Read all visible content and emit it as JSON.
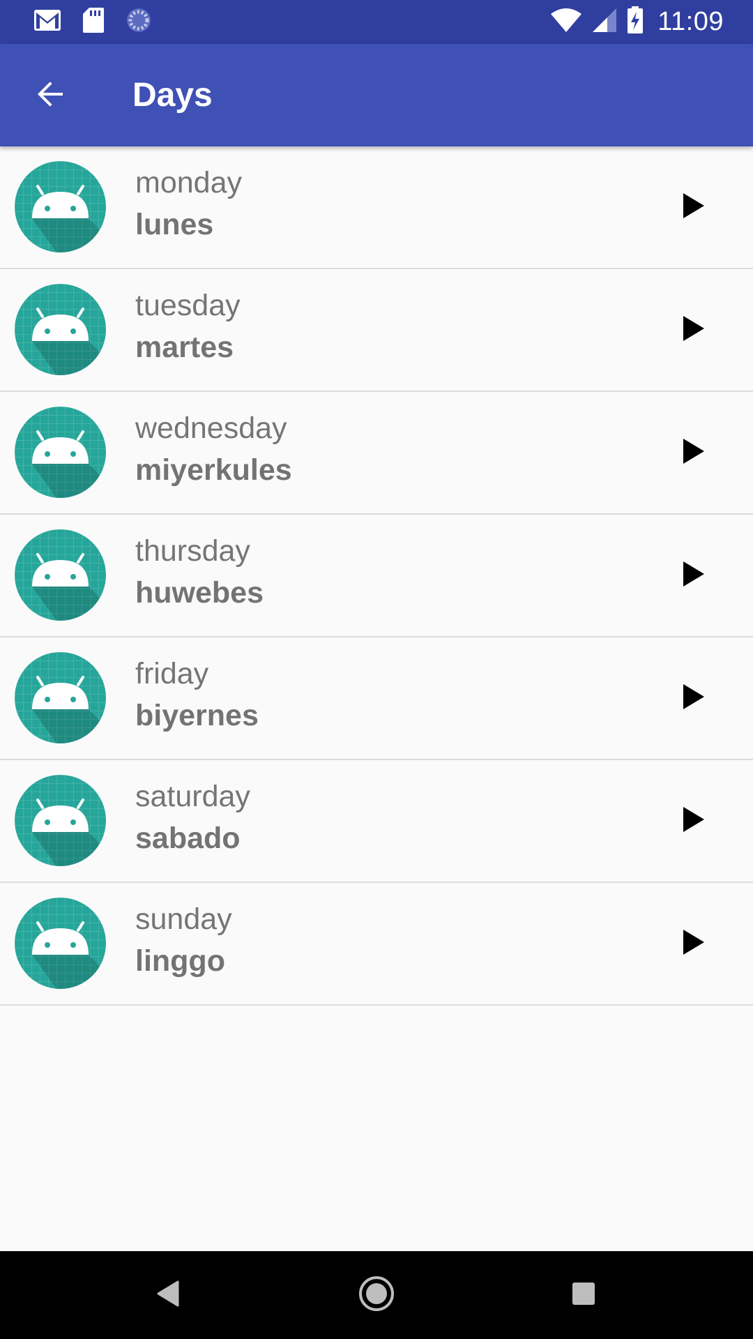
{
  "status_bar": {
    "time": "11:09",
    "left_icons": [
      "gmail-icon",
      "sd-card-icon",
      "sync-icon"
    ],
    "right_icons": [
      "wifi-icon",
      "cell-signal-icon",
      "battery-charging-icon"
    ]
  },
  "app_bar": {
    "title": "Days",
    "back_icon": "arrow-back-icon"
  },
  "days": [
    {
      "english": "monday",
      "translation": "lunes"
    },
    {
      "english": "tuesday",
      "translation": "martes"
    },
    {
      "english": "wednesday",
      "translation": "miyerkules"
    },
    {
      "english": "thursday",
      "translation": "huwebes"
    },
    {
      "english": "friday",
      "translation": "biyernes"
    },
    {
      "english": "saturday",
      "translation": "sabado"
    },
    {
      "english": "sunday",
      "translation": "linggo"
    }
  ],
  "row_icons": {
    "avatar": "android-icon",
    "action": "play-icon"
  },
  "nav_bar": {
    "buttons": [
      "back-triangle-icon",
      "home-circle-icon",
      "recents-square-icon"
    ]
  },
  "colors": {
    "status_bar": "#303f9f",
    "app_bar": "#3f51b5",
    "avatar": "#26a69a",
    "background": "#fafafa",
    "divider": "#dcdcdc",
    "primary_text": "#757575",
    "nav_bar": "#000000"
  }
}
